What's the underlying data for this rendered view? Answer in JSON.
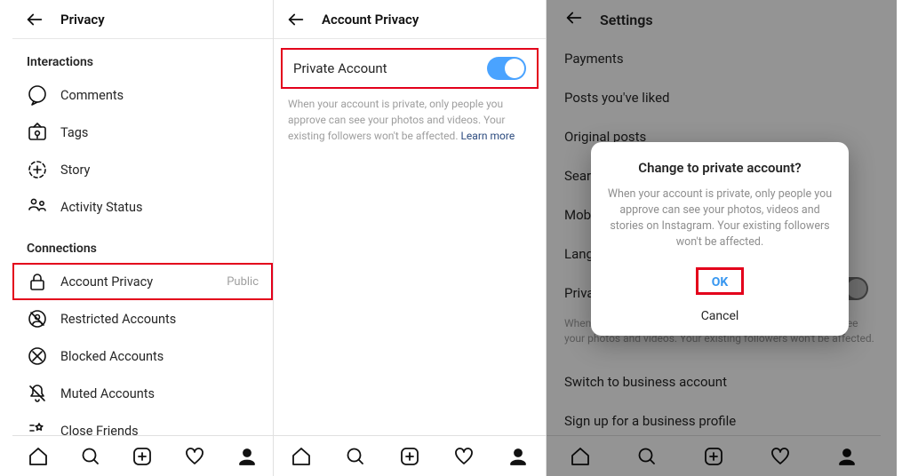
{
  "panel1": {
    "title": "Privacy",
    "section_interactions": "Interactions",
    "section_connections": "Connections",
    "rows_interactions": [
      {
        "label": "Comments"
      },
      {
        "label": "Tags"
      },
      {
        "label": "Story"
      },
      {
        "label": "Activity Status"
      }
    ],
    "rows_connections": [
      {
        "label": "Account Privacy",
        "meta": "Public"
      },
      {
        "label": "Restricted Accounts"
      },
      {
        "label": "Blocked Accounts"
      },
      {
        "label": "Muted Accounts"
      },
      {
        "label": "Close Friends"
      }
    ]
  },
  "panel2": {
    "title": "Account Privacy",
    "toggle_label": "Private Account",
    "desc": "When your account is private, only people you approve can see your photos and videos. Your existing followers won't be affected. ",
    "learn_more": "Learn more"
  },
  "panel3": {
    "title": "Settings",
    "bg_rows": [
      "Payments",
      "Posts you've liked",
      "Original posts",
      "Search history",
      "Mobile data use",
      "Language",
      "Private account"
    ],
    "bg_desc": "When your account is private, only people you approve will see your photos and videos. Your existing followers won't be affected.",
    "bg_rows2": [
      "Switch to business account",
      "Sign up for a business profile"
    ],
    "dialog": {
      "title": "Change to private account?",
      "desc": "When your account is private, only people you approve can see your photos, videos and stories on Instagram. Your existing followers won't be affected.",
      "ok": "OK",
      "cancel": "Cancel"
    }
  }
}
